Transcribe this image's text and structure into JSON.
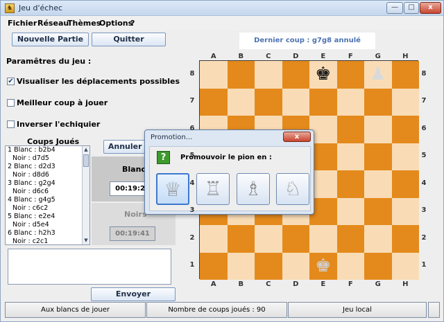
{
  "window": {
    "title": "Jeu d'échec",
    "min_glyph": "—",
    "max_glyph": "□",
    "close_glyph": "x"
  },
  "menu": [
    "Fichier",
    "Réseau",
    "Thèmes",
    "Options",
    "?"
  ],
  "buttons": {
    "new_game": "Nouvelle Partie",
    "quit": "Quitter",
    "undo": "Annuler coup",
    "send": "Envoyer"
  },
  "settings": {
    "title": "Paramêtres du jeu :",
    "options": [
      {
        "label": "Visualiser les déplacements possibles",
        "checked": true
      },
      {
        "label": "Meilleur coup à jouer",
        "checked": false
      },
      {
        "label": "Inverser l'echiquier",
        "checked": false
      }
    ]
  },
  "moves": {
    "header": "Coups Joués",
    "lines": [
      "1 Blanc : b2b4",
      "Noir : d7d5",
      "2 Blanc : d2d3",
      "Noir : d8d6",
      "3 Blanc : g2g4",
      "Noir : d6c6",
      "4 Blanc : g4g5",
      "Noir : c6c2",
      "5 Blanc : e2e4",
      "Noir : d5e4",
      "6 Blanc : h2h3",
      "Noir : c2c1"
    ]
  },
  "clocks": {
    "white_label": "Blancs",
    "white_time": "00:19:28",
    "black_label": "Noirs",
    "black_time": "00:19:41"
  },
  "last_move": "Dernier coup : g7g8 annulé",
  "board": {
    "files": [
      "A",
      "B",
      "C",
      "D",
      "E",
      "F",
      "G",
      "H"
    ],
    "ranks": [
      "8",
      "7",
      "6",
      "5",
      "4",
      "3",
      "2",
      "1"
    ],
    "colors": {
      "light": "#f9dcb6",
      "dark": "#e48a1c"
    },
    "pieces": [
      {
        "square": "e8",
        "glyph": "♚",
        "color": "#1a1a1a",
        "name": "black-king-icon"
      },
      {
        "square": "g8",
        "glyph": "♟",
        "color": "#d9d9d9",
        "name": "white-pawn-icon"
      },
      {
        "square": "e1",
        "glyph": "♚",
        "color": "#cfcfcf",
        "name": "white-king-icon"
      }
    ]
  },
  "promotion": {
    "title": "Promotion...",
    "message": "Promouvoir le pion en :",
    "close_glyph": "x",
    "choices": [
      {
        "name": "queen",
        "glyph": "♕",
        "selected": true
      },
      {
        "name": "rook",
        "glyph": "♖",
        "selected": false
      },
      {
        "name": "bishop",
        "glyph": "♗",
        "selected": false
      },
      {
        "name": "knight",
        "glyph": "♘",
        "selected": false
      }
    ]
  },
  "status": [
    "Aux blancs de jouer",
    "Nombre de coups joués : 90",
    "Jeu local"
  ]
}
